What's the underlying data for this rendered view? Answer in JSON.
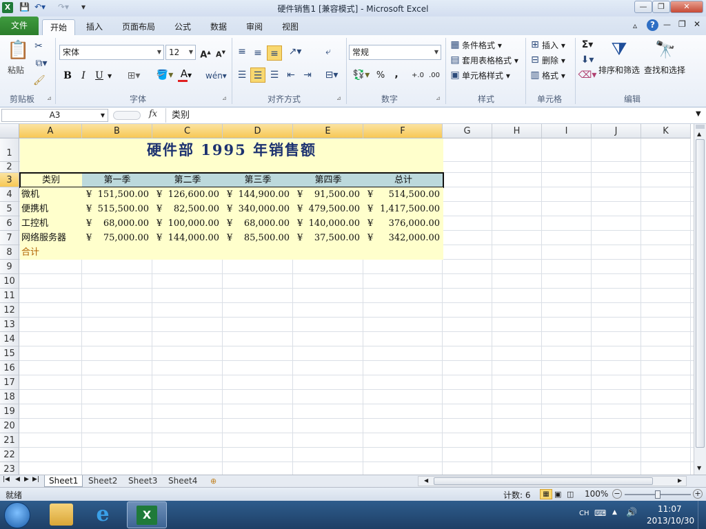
{
  "window": {
    "title": "硬件销售1  [兼容模式]  -  Microsoft Excel",
    "controls": {
      "minimize": "—",
      "maximize": "❐",
      "close": "✕"
    }
  },
  "tabs": [
    "文件",
    "开始",
    "插入",
    "页面布局",
    "公式",
    "数据",
    "审阅",
    "视图"
  ],
  "ribbon": {
    "clipboard": {
      "paste": "粘贴",
      "label": "剪贴板"
    },
    "font": {
      "name": "宋体",
      "size": "12",
      "label": "字体",
      "bold": "B",
      "italic": "I",
      "underline": "U"
    },
    "alignment": {
      "label": "对齐方式"
    },
    "number": {
      "format": "常规",
      "label": "数字",
      "percent": "%",
      "comma": ","
    },
    "styles": {
      "conditional": "条件格式",
      "table": "套用表格格式",
      "cell": "单元格样式",
      "label": "样式"
    },
    "cells": {
      "insert": "插入",
      "delete": "删除",
      "format": "格式",
      "label": "单元格"
    },
    "editing": {
      "sort": "排序和筛选",
      "find": "查找和选择",
      "label": "编辑",
      "sigma": "Σ"
    }
  },
  "formula_bar": {
    "name_box": "A3",
    "fx": "fx",
    "content": "类别"
  },
  "columns": [
    "A",
    "B",
    "C",
    "D",
    "E",
    "F",
    "G",
    "H",
    "I",
    "J",
    "K"
  ],
  "rows": [
    "1",
    "2",
    "3",
    "4",
    "5",
    "6",
    "7",
    "8",
    "9",
    "10",
    "11",
    "12",
    "13",
    "14",
    "15",
    "16",
    "17",
    "18",
    "19",
    "20",
    "21",
    "22",
    "23"
  ],
  "sheet": {
    "title": "硬件部  1995  年销售额",
    "headers": [
      "类别",
      "第一季",
      "第二季",
      "第三季",
      "第四季",
      "总计"
    ],
    "data": [
      {
        "category": "微机",
        "values": [
          "151,500.00",
          "126,600.00",
          "144,900.00",
          "91,500.00",
          "514,500.00"
        ]
      },
      {
        "category": "便携机",
        "values": [
          "515,500.00",
          "82,500.00",
          "340,000.00",
          "479,500.00",
          "1,417,500.00"
        ]
      },
      {
        "category": "工控机",
        "values": [
          "68,000.00",
          "100,000.00",
          "68,000.00",
          "140,000.00",
          "376,000.00"
        ]
      },
      {
        "category": "网络服务器",
        "values": [
          "75,000.00",
          "144,000.00",
          "85,500.00",
          "37,500.00",
          "342,000.00"
        ]
      }
    ],
    "total_label": "合计",
    "currency": "¥"
  },
  "sheet_tabs": [
    "Sheet1",
    "Sheet2",
    "Sheet3",
    "Sheet4"
  ],
  "status": {
    "ready": "就绪",
    "count": "计数: 6",
    "zoom": "100%"
  },
  "taskbar": {
    "lang": "CH",
    "time": "11:07",
    "date": "2013/10/30"
  },
  "colors": {
    "data_fill": "#ffffcc",
    "header_fill": "#bcd9dc",
    "title_color": "#1d3270",
    "selected_header": "#f7c854",
    "total_color": "#b06000"
  }
}
